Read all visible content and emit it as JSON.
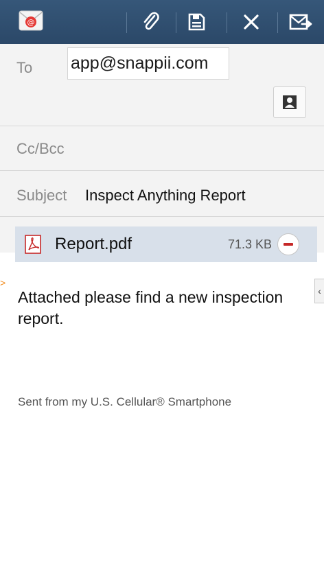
{
  "toolbar": {
    "icons": [
      "email-app-icon",
      "attach-icon",
      "save-draft-icon",
      "discard-icon",
      "send-icon"
    ]
  },
  "compose": {
    "to_label": "To",
    "to_value": "app@snappii.com",
    "cc_bcc_label": "Cc/Bcc",
    "subject_label": "Subject",
    "subject_value": "Inspect Anything Report"
  },
  "attachment": {
    "name": "Report.pdf",
    "size": "71.3 KB"
  },
  "message": {
    "body": "Attached please find a new inspection report.",
    "signature": "Sent from my U.S. Cellular® Smartphone"
  },
  "colors": {
    "toolbar": "#2f4f6e",
    "attachment_bg": "#d8e0ea",
    "remove": "#c62828",
    "accent": "#f08a1c"
  }
}
